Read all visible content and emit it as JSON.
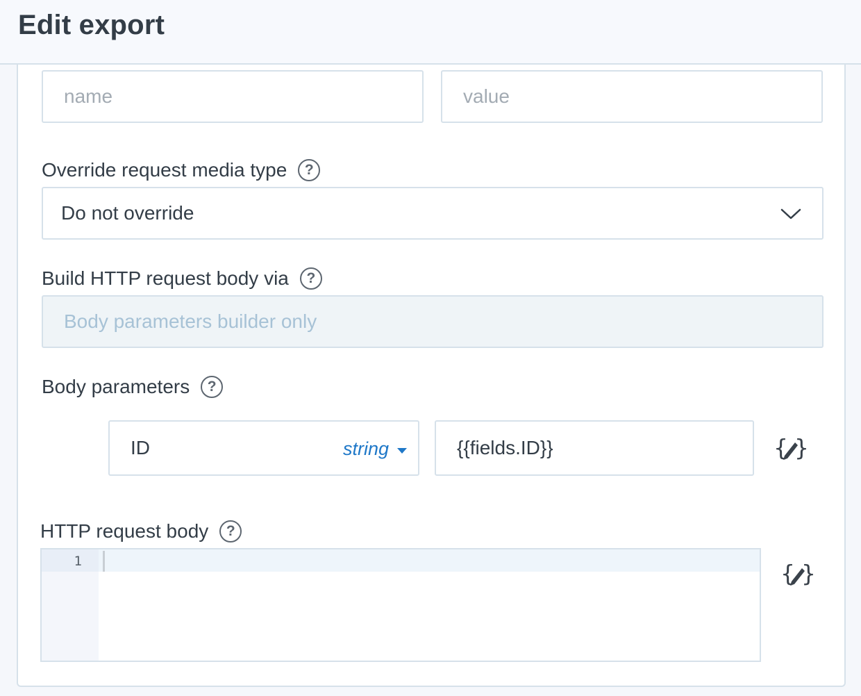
{
  "header": {
    "title": "Edit export"
  },
  "headers_row": {
    "name_placeholder": "name",
    "value_placeholder": "value"
  },
  "media_type": {
    "label": "Override request media type",
    "selected": "Do not override",
    "help_icon": "help-circle-icon",
    "chevron_icon": "chevron-down-icon"
  },
  "body_via": {
    "label": "Build HTTP request body via",
    "value": "Body parameters builder only",
    "disabled": true
  },
  "body_parameters": {
    "label": "Body parameters",
    "rows": [
      {
        "name": "ID",
        "type": "string",
        "value": "{{fields.ID}}"
      }
    ],
    "editor_icon": "handlebars-editor-icon"
  },
  "http_body": {
    "label": "HTTP request body",
    "line_numbers": [
      "1"
    ],
    "content": "",
    "editor_icon": "handlebars-editor-icon"
  },
  "help_text": "?",
  "colors": {
    "accent": "#1f78c8",
    "border": "#d6e1ea",
    "disabled_bg": "#eff4f7",
    "disabled_text": "#a7c2d6"
  }
}
